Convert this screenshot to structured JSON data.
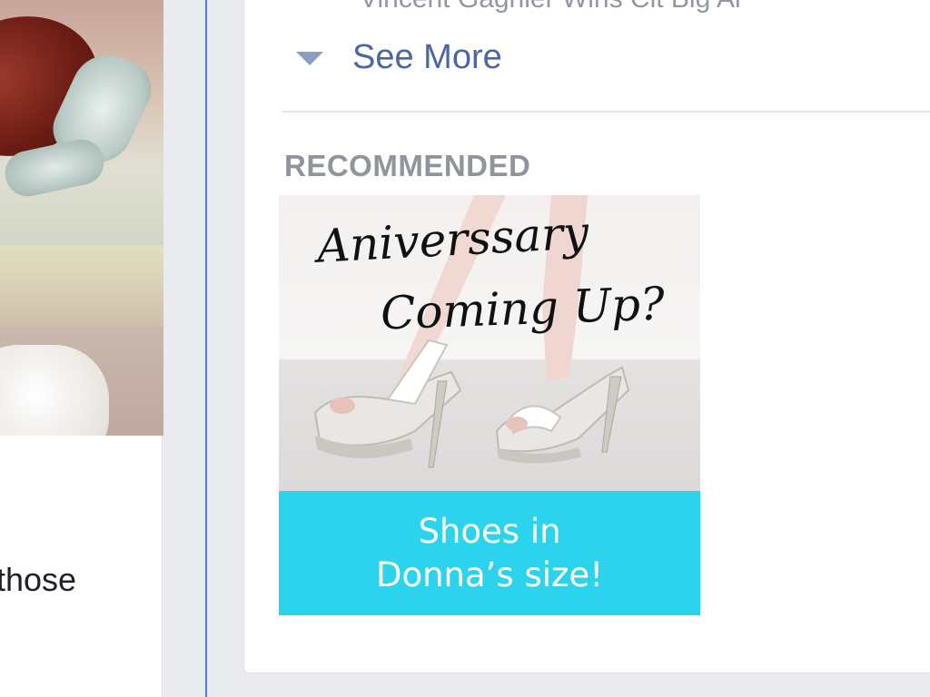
{
  "feed": {
    "post_text": "those"
  },
  "sidebar": {
    "cut_off_text": "Vincent Gagnier Wins Cit Big Ai",
    "see_more_label": "See More",
    "section_heading": "RECOMMENDED",
    "ad": {
      "headline_line1": "Aniverssary",
      "headline_line2": "Coming Up?",
      "banner_line1": "Shoes in",
      "banner_line2": "Donna’s size!",
      "banner_color": "#2bd3ed"
    }
  },
  "colors": {
    "link": "#4b67a1",
    "heading": "#90949c",
    "accent_rule": "#4a7fe3"
  },
  "icons": {
    "see_more": "caret-down-icon"
  }
}
